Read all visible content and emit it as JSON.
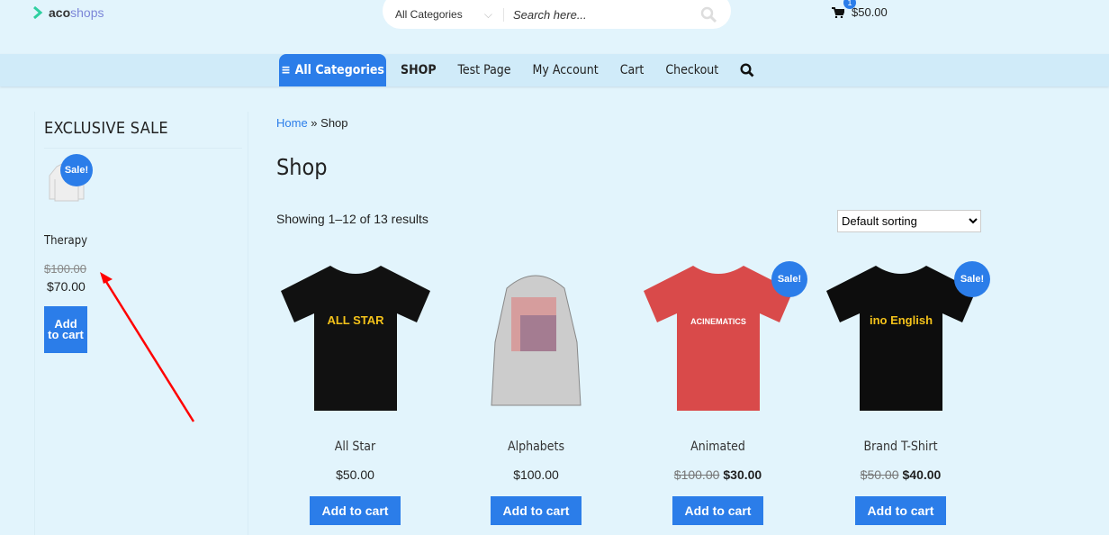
{
  "header": {
    "logo_a": "aco",
    "logo_b": "shops",
    "search_category": "All Categories",
    "search_placeholder": "Search here...",
    "cart_count": "1",
    "cart_total": "$50.00"
  },
  "nav": {
    "all_categories": "All Categories",
    "items": [
      "SHOP",
      "Test Page",
      "My Account",
      "Cart",
      "Checkout"
    ]
  },
  "sidebar": {
    "title": "EXCLUSIVE SALE",
    "product": {
      "name": "Therapy",
      "old_price": "$100.00",
      "price": "$70.00",
      "sale": "Sale!",
      "button": "Add to cart"
    }
  },
  "breadcrumb": {
    "home": "Home",
    "sep": " » ",
    "current": "Shop"
  },
  "page_title": "Shop",
  "result_count": "Showing 1–12 of 13 results",
  "sorting": {
    "selected": "Default sorting"
  },
  "products": [
    {
      "name": "All Star",
      "old_price": "",
      "price": "$50.00",
      "sale": "",
      "button": "Add to cart",
      "color": "#111111",
      "print": "ALL STAR"
    },
    {
      "name": "Alphabets",
      "old_price": "",
      "price": "$100.00",
      "sale": "",
      "button": "Add to cart",
      "color": "#cccccc",
      "print": ""
    },
    {
      "name": "Animated",
      "old_price": "$100.00",
      "price": "$30.00",
      "sale": "Sale!",
      "button": "Add to cart",
      "color": "#d94a4a",
      "print": "ACINEMATICS"
    },
    {
      "name": "Brand T-Shirt",
      "old_price": "$50.00",
      "price": "$40.00",
      "sale": "Sale!",
      "button": "Add to cart",
      "color": "#0d0d0d",
      "print": "ino English"
    }
  ],
  "colors": {
    "accent": "#2b7de9",
    "background": "#e2f4fc",
    "nav": "#d0ebf9"
  }
}
